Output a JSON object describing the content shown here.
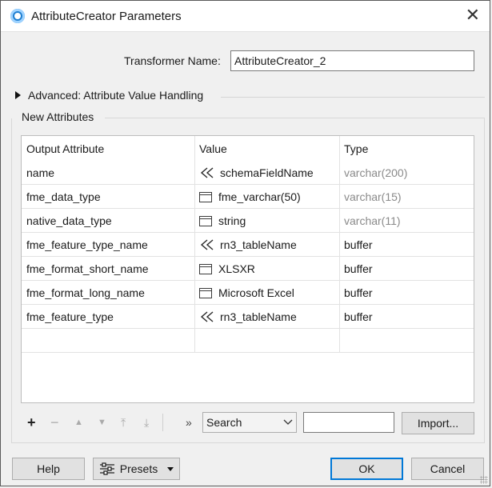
{
  "window": {
    "title": "AttributeCreator Parameters",
    "app_icon": "fme-icon",
    "close_icon": "close-icon"
  },
  "transformer": {
    "label": "Transformer Name:",
    "value": "AttributeCreator_2"
  },
  "advanced": {
    "label": "Advanced: Attribute Value Handling"
  },
  "new_attributes": {
    "title": "New Attributes",
    "columns": [
      "Output Attribute",
      "Value",
      "Type"
    ],
    "rows": [
      {
        "attribute": "name",
        "value_icon": "attribute-value-icon",
        "value": "schemaFieldName",
        "type": "varchar(200)",
        "type_muted": true
      },
      {
        "attribute": "fme_data_type",
        "value_icon": "string-value-icon",
        "value": "fme_varchar(50)",
        "type": "varchar(15)",
        "type_muted": true
      },
      {
        "attribute": "native_data_type",
        "value_icon": "string-value-icon",
        "value": "string",
        "type": "varchar(11)",
        "type_muted": true
      },
      {
        "attribute": "fme_feature_type_name",
        "value_icon": "attribute-value-icon",
        "value": "rn3_tableName",
        "type": "buffer",
        "type_muted": false
      },
      {
        "attribute": "fme_format_short_name",
        "value_icon": "string-value-icon",
        "value": "XLSXR",
        "type": "buffer",
        "type_muted": false
      },
      {
        "attribute": "fme_format_long_name",
        "value_icon": "string-value-icon",
        "value": "Microsoft Excel",
        "type": "buffer",
        "type_muted": false
      },
      {
        "attribute": "fme_feature_type",
        "value_icon": "attribute-value-icon",
        "value": "rn3_tableName",
        "type": "buffer",
        "type_muted": false
      }
    ]
  },
  "toolbar": {
    "add": "+",
    "remove": "−",
    "move_up": "▲",
    "move_down": "▼",
    "move_top": "⤒",
    "move_bottom": "⤓",
    "expand": "»",
    "search_select": "Search",
    "search_value": "",
    "import_label": "Import..."
  },
  "footer": {
    "help_label": "Help",
    "presets_label": "Presets",
    "ok_label": "OK",
    "cancel_label": "Cancel"
  }
}
